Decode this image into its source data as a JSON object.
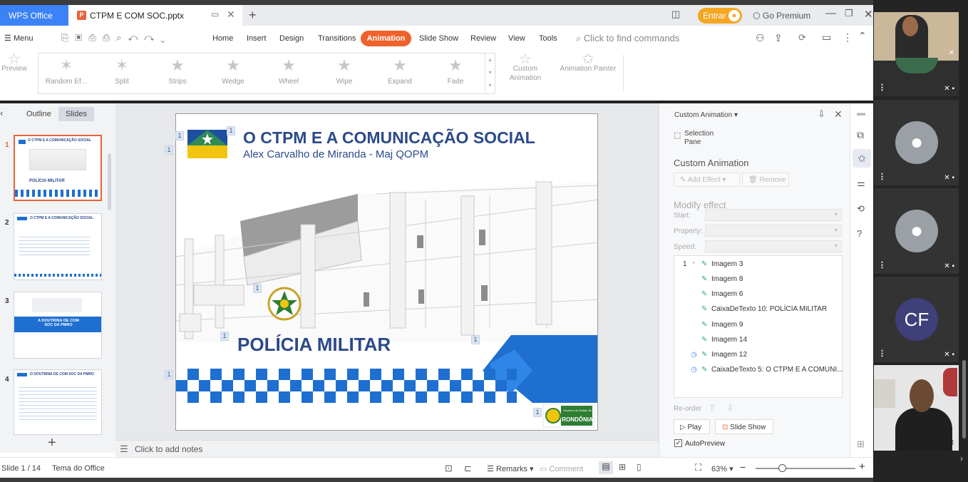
{
  "titlebar": {
    "app_tab": "WPS Office",
    "doc_tab": "CTPM E COM SOC.pptx",
    "doc_tab_icon": "P",
    "entrar": "Entrar",
    "go_premium": "Go Premium"
  },
  "menubar": {
    "menu_label": "Menu",
    "tabs": [
      "Home",
      "Insert",
      "Design",
      "Transitions",
      "Animation",
      "Slide Show",
      "Review",
      "View",
      "Tools"
    ],
    "active_tab": "Animation",
    "search_placeholder": "Click to find commands"
  },
  "ribbon": {
    "preview": "Preview",
    "effects": [
      "Random Ef...",
      "Split",
      "Strips",
      "Wedge",
      "Wheel",
      "Wipe",
      "Expand",
      "Fade"
    ],
    "custom_animation": "Custom Animation",
    "animation_painter": "Animation Painter"
  },
  "left_pane": {
    "tabs": [
      "Outline",
      "Slides"
    ],
    "active_tab": "Slides",
    "slides": [
      {
        "num": "1",
        "title": "O CTPM E A COMUNICAÇÃO SOCIAL",
        "sub": "POLÍCIA MILITAR"
      },
      {
        "num": "2",
        "title": "O CTPM E A COMUNICAÇÃO SOCIAL",
        "sub": ""
      },
      {
        "num": "3",
        "title": "A DOUTRINA DE COM SOC DA PMRO",
        "sub": ""
      },
      {
        "num": "4",
        "title": "O DOUTRINA DE COM SOC DA PMRO",
        "sub": ""
      }
    ],
    "add_slide": "+"
  },
  "slide": {
    "title": "O CTPM E A COMUNICAÇÃO SOCIAL",
    "subtitle": "Alex Carvalho de Miranda - Maj QOPM",
    "policia": "POLÍCIA MILITAR",
    "seal_small": "Governo do Estado de",
    "seal_big": "RONDÔNIA",
    "anim_badges": [
      "1",
      "1",
      "1",
      "1",
      "1",
      "1",
      "1",
      "1"
    ]
  },
  "notes": {
    "placeholder": "Click to add notes"
  },
  "custom_anim_pane": {
    "header": "Custom Animation",
    "selection_pane": "Selection Pane",
    "title": "Custom Animation",
    "add_effect": "Add Effect",
    "remove": "Remove",
    "modify_effect": "Modify effect",
    "start_label": "Start:",
    "property_label": "Property:",
    "speed_label": "Speed:",
    "list_index": "1",
    "items": [
      "Imagem 3",
      "Imagem 8",
      "Imagem 6",
      "CaixaDeTexto 10: POLÍCIA MILITAR",
      "Imagem 9",
      "Imagem 14",
      "Imagem 12",
      "CaixaDeTexto 5: O CTPM E A COMUNI..."
    ],
    "reorder": "Re-order",
    "play": "Play",
    "slide_show": "Slide Show",
    "autopreview": "AutoPreview"
  },
  "statusbar": {
    "slide_info": "Slide 1 / 14",
    "theme": "Tema do Office",
    "remarks": "Remarks",
    "comment": "Comment",
    "zoom": "63%",
    "zoom_level": 0.63
  },
  "video": {
    "initials": "CF",
    "tile_colors": {
      "cf": "#3f3f7a",
      "generic": "#9aa0a6"
    }
  },
  "colors": {
    "accent": "#f0622b",
    "wps_blue": "#3b82f6",
    "slide_title": "#2b4a8b",
    "slide_blue": "#1e6fd0",
    "entrar_orange": "#f5a623"
  }
}
